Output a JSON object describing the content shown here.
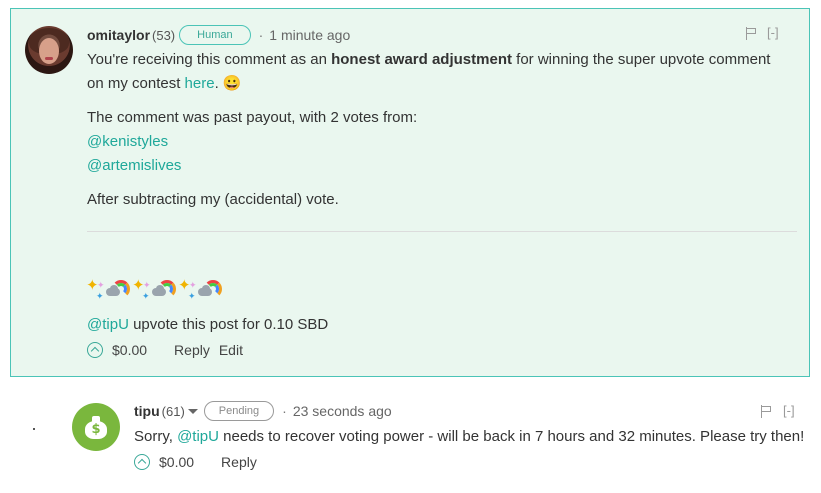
{
  "comment1": {
    "author": "omitaylor",
    "reputation": "(53)",
    "badge": "Human",
    "separator": "·",
    "time": "1 minute ago",
    "collapse": "[-]",
    "line1_pre": "You're receiving this comment as an ",
    "line1_bold": "honest award adjustment",
    "line1_post": " for winning the super upvote comment",
    "line2_pre": "on my contest ",
    "line2_link": "here",
    "line2_post": ". 😀",
    "para2": "The comment was past payout, with 2 votes from:",
    "voter1": "@kenistyles",
    "voter2": "@artemislives",
    "para3": "After subtracting my (accidental) vote.",
    "tip_link": "@tipU",
    "tip_text": " upvote this post for 0.10 SBD",
    "payout": "$0.00",
    "reply": "Reply",
    "edit": "Edit"
  },
  "comment2": {
    "author": "tipu",
    "reputation": "(61)",
    "badge": "Pending",
    "separator": "·",
    "time": "23 seconds ago",
    "collapse": "[-]",
    "text_pre": "Sorry, ",
    "text_link": "@tipU",
    "text_post": " needs to recover voting power - will be back in 7 hours and 32 minutes. Please try then!",
    "payout": "$0.00",
    "reply": "Reply"
  },
  "icons": {
    "moneybag_symbol": "$"
  },
  "colors": {
    "accent": "#1fa89a",
    "highlight_bg": "#eaf7ef",
    "highlight_border": "#4bc4b7",
    "tipu_avatar": "#7ab73d"
  }
}
